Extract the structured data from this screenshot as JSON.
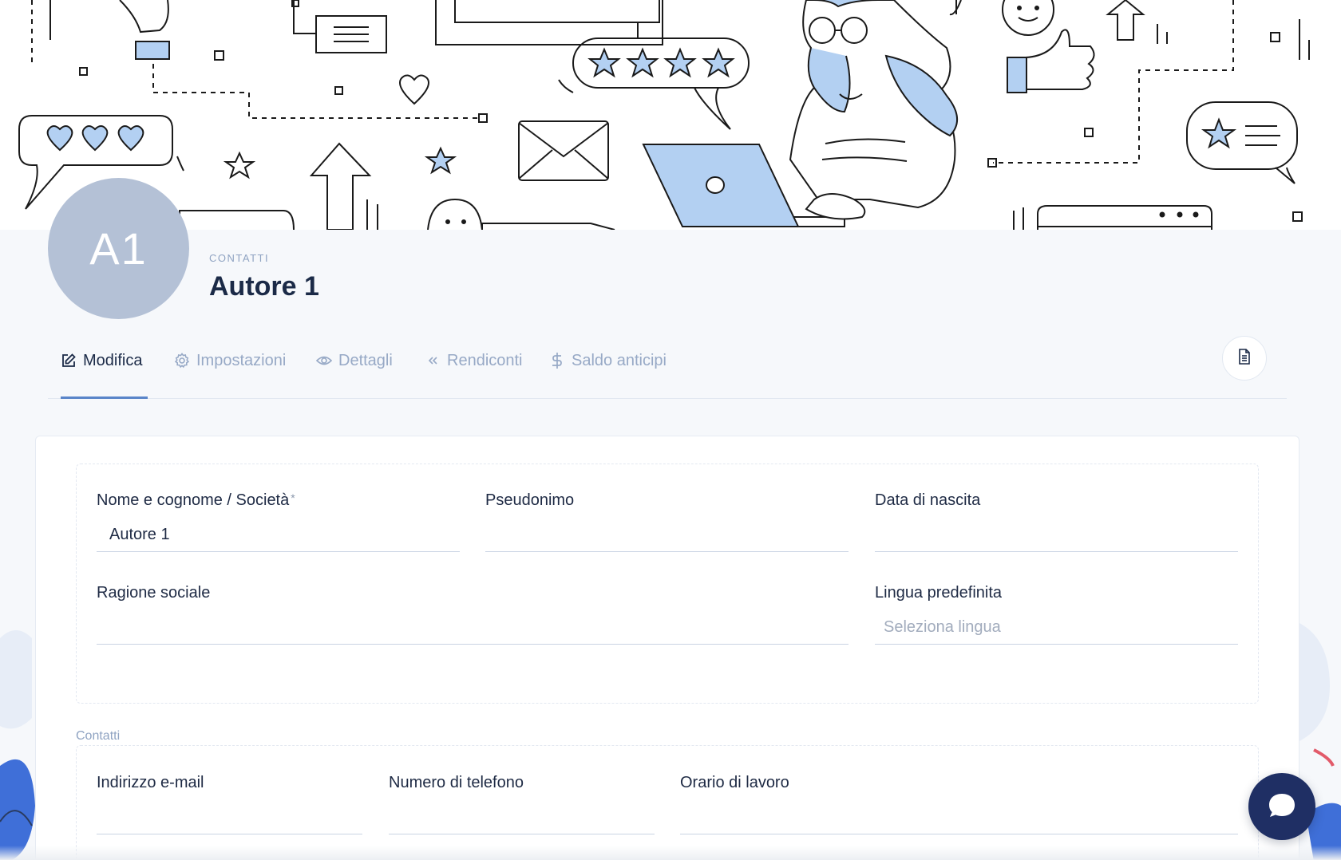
{
  "header": {
    "avatar_initials": "A1",
    "breadcrumb": "CONTATTI",
    "title": "Autore 1"
  },
  "tabs": [
    {
      "label": "Modifica",
      "icon": "edit-icon",
      "active": true
    },
    {
      "label": "Impostazioni",
      "icon": "gear-icon",
      "active": false
    },
    {
      "label": "Dettagli",
      "icon": "eye-icon",
      "active": false
    },
    {
      "label": "Rendiconti",
      "icon": "double-chevron-left-icon",
      "active": false
    },
    {
      "label": "Saldo anticipi",
      "icon": "dollar-icon",
      "active": false
    }
  ],
  "toolbar": {
    "document_icon": "document-icon"
  },
  "form": {
    "name": {
      "label": "Nome e cognome / Società",
      "required_mark": "*",
      "value": "Autore 1"
    },
    "pseudonym": {
      "label": "Pseudonimo",
      "value": ""
    },
    "birthdate": {
      "label": "Data di nascita",
      "value": ""
    },
    "company_name": {
      "label": "Ragione sociale",
      "value": ""
    },
    "language": {
      "label": "Lingua predefinita",
      "placeholder": "Seleziona lingua"
    }
  },
  "contacts": {
    "legend": "Contatti",
    "email": {
      "label": "Indirizzo e-mail",
      "value": ""
    },
    "phone": {
      "label": "Numero di telefono",
      "value": ""
    },
    "hours": {
      "label": "Orario di lavoro",
      "value": ""
    }
  },
  "colors": {
    "accent": "#5a85c9",
    "avatar_bg": "#b4c1d6",
    "chat_bg": "#1f2f64",
    "illustration_blue": "#b3d0f2"
  }
}
